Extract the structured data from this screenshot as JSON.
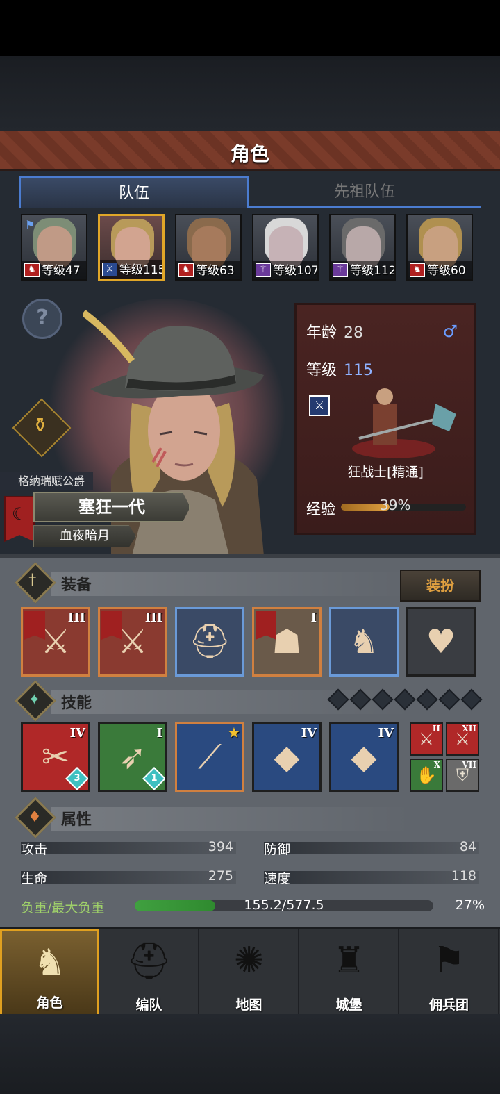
{
  "screen_title": "角色",
  "tabs": [
    {
      "label": "队伍",
      "active": true
    },
    {
      "label": "先祖队伍",
      "active": false
    }
  ],
  "roster": [
    {
      "level": "等级47",
      "skin": "#c09a86",
      "hair": "#7d8d76",
      "cls_icon": "wolf-icon",
      "cls_color": "#b02020"
    },
    {
      "level": "等级115",
      "skin": "#d2a490",
      "hair": "#b89a5a",
      "cls_icon": "sword-icon",
      "cls_color": "#2a4a90"
    },
    {
      "level": "等级63",
      "skin": "#a67a5c",
      "hair": "#8a6a4c",
      "cls_icon": "wolf-icon",
      "cls_color": "#b02020"
    },
    {
      "level": "等级107",
      "skin": "#c6b2b6",
      "hair": "#d8d8d8",
      "cls_icon": "staff-icon",
      "cls_color": "#6a3a9a"
    },
    {
      "level": "等级112",
      "skin": "#b8a8a8",
      "hair": "#6a6a6a",
      "cls_icon": "staff-icon",
      "cls_color": "#6a3a9a"
    },
    {
      "level": "等级60",
      "skin": "#c8a080",
      "hair": "#b09050",
      "cls_icon": "wolf-icon",
      "cls_color": "#b02020"
    }
  ],
  "character": {
    "house": "格纳瑞赋公爵",
    "name": "塞狂一代",
    "epithet": "血夜暗月",
    "age_label": "年龄",
    "age": "28",
    "level_label": "等级",
    "level": "115",
    "gender_icon": "male-icon",
    "class_name": "狂战士[精通]",
    "xp_label": "经验",
    "xp_percent": 39,
    "xp_text": "39%"
  },
  "equipment": {
    "title": "装备",
    "dress_button": "装扮",
    "slots": [
      {
        "name": "weapon-axe",
        "rank": "III",
        "flag": true,
        "color": "#8a3a30",
        "icon": "⚔"
      },
      {
        "name": "weapon-axe-2",
        "rank": "III",
        "flag": true,
        "color": "#8a3a30",
        "icon": "⚔"
      },
      {
        "name": "helmet",
        "rank": "",
        "flag": false,
        "color": "#3a4a66",
        "icon": "⛑"
      },
      {
        "name": "armor",
        "rank": "I",
        "flag": true,
        "color": "#6a5a4a",
        "icon": "☗"
      },
      {
        "name": "boots",
        "rank": "",
        "flag": false,
        "color": "#3a4a66",
        "icon": "♞"
      },
      {
        "name": "amulet",
        "rank": "",
        "flag": false,
        "color": "#3a3d42",
        "icon": "♥"
      }
    ]
  },
  "skills": {
    "title": "技能",
    "slot_count": 7,
    "items": [
      {
        "rank": "IV",
        "color": "#b02828",
        "badge": "3",
        "icon": "✂"
      },
      {
        "rank": "I",
        "color": "#3a7a3a",
        "badge": "1",
        "icon": "➶"
      },
      {
        "rank": "★",
        "color": "#2a4a80",
        "badge": "",
        "icon": "⟋"
      },
      {
        "rank": "IV",
        "color": "#2a4a80",
        "badge": "",
        "icon": "◆"
      },
      {
        "rank": "IV",
        "color": "#2a4a80",
        "badge": "",
        "icon": "◆"
      }
    ],
    "small": [
      {
        "rank": "II",
        "color": "#b02828",
        "icon": "⚔"
      },
      {
        "rank": "XII",
        "color": "#b02828",
        "icon": "⚔"
      },
      {
        "rank": "X",
        "color": "#3a7a3a",
        "icon": "✋"
      },
      {
        "rank": "VII",
        "color": "#6a6a6a",
        "icon": "⛨"
      }
    ]
  },
  "attributes": {
    "title": "属性",
    "attack_label": "攻击",
    "attack": "394",
    "defense_label": "防御",
    "defense": "84",
    "hp_label": "生命",
    "hp": "275",
    "speed_label": "速度",
    "speed": "118",
    "load_label": "负重/最大负重",
    "load_value": "155.2/577.5",
    "load_percent": 27,
    "load_percent_text": "27%"
  },
  "nav": [
    {
      "label": "角色",
      "icon": "knight-icon",
      "glyph": "♞",
      "active": true
    },
    {
      "label": "编队",
      "icon": "helmet-icon",
      "glyph": "⛑",
      "active": false
    },
    {
      "label": "地图",
      "icon": "compass-icon",
      "glyph": "✺",
      "active": false
    },
    {
      "label": "城堡",
      "icon": "castle-icon",
      "glyph": "♜",
      "active": false
    },
    {
      "label": "佣兵团",
      "icon": "banner-icon",
      "glyph": "⚑",
      "active": false
    }
  ]
}
